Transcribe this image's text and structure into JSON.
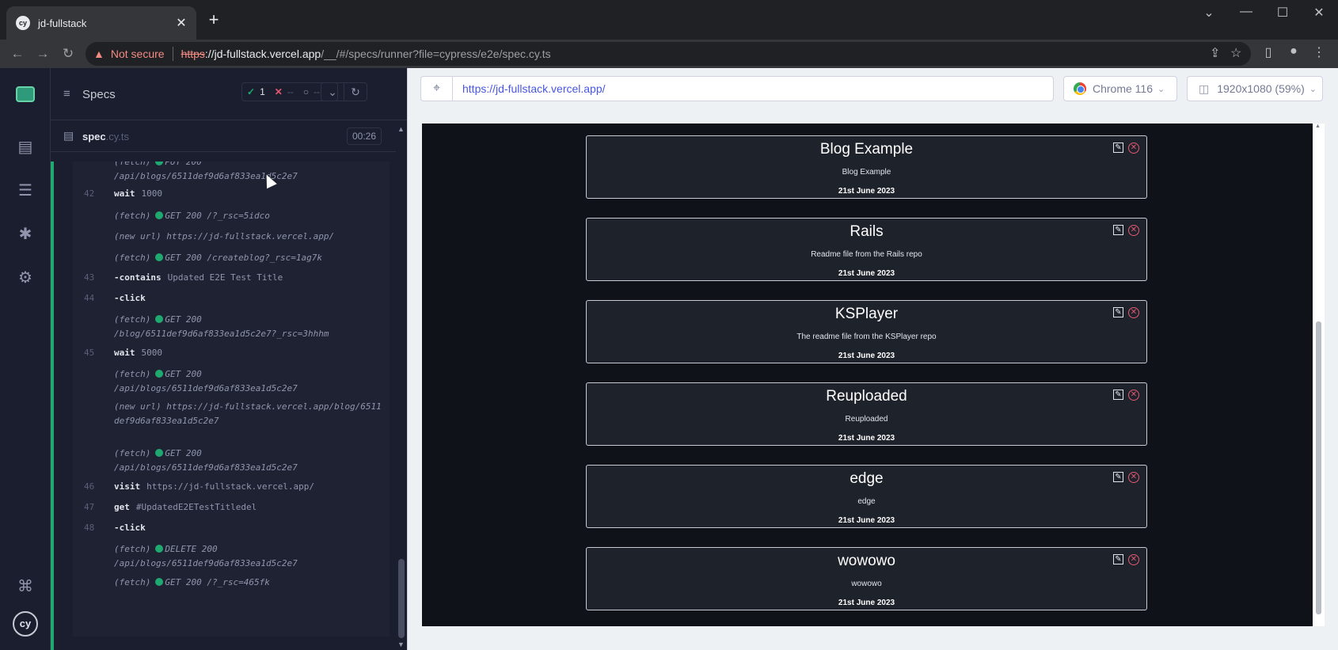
{
  "browser": {
    "tab_title": "jd-fullstack",
    "tab_favicon": "cy",
    "security_label": "Not secure",
    "url_scheme": "https",
    "url_host": "://jd-fullstack.vercel.app",
    "url_path": "/__/#/specs/runner?file=cypress/e2e/spec.cy.ts"
  },
  "reporter": {
    "specs_label": "Specs",
    "stats": {
      "passed": "1",
      "failed": "--",
      "pending": "--"
    },
    "file": {
      "name": "spec",
      "ext": ".cy.ts",
      "duration": "00:26"
    },
    "commands": [
      {
        "num": "",
        "text": "(fetch)",
        "method": "PUT 200",
        "path": "/api/blogs/6511def9d6af833ea1d5c2e7",
        "kind": "fetch"
      },
      {
        "num": "42",
        "name": "wait",
        "arg": "1000",
        "kind": "cmd"
      },
      {
        "num": "",
        "text": "(fetch)",
        "method": "GET 200 /?_rsc=5idco",
        "path": "",
        "kind": "fetch"
      },
      {
        "num": "",
        "text": "(new url)",
        "method": "",
        "path": "https://jd-fullstack.vercel.app/",
        "kind": "newurl"
      },
      {
        "num": "",
        "text": "(fetch)",
        "method": "GET 200 /createblog?_rsc=1ag7k",
        "path": "",
        "kind": "fetch"
      },
      {
        "num": "43",
        "name": "-contains",
        "arg": "Updated E2E Test Title",
        "kind": "cmd"
      },
      {
        "num": "44",
        "name": "-click",
        "arg": "",
        "kind": "cmd"
      },
      {
        "num": "",
        "text": "(fetch)",
        "method": "GET 200",
        "path": "/blog/6511def9d6af833ea1d5c2e7?_rsc=3hhhm",
        "kind": "fetch"
      },
      {
        "num": "45",
        "name": "wait",
        "arg": "5000",
        "kind": "cmd"
      },
      {
        "num": "",
        "text": "(fetch)",
        "method": "GET 200",
        "path": "/api/blogs/6511def9d6af833ea1d5c2e7",
        "kind": "fetch"
      },
      {
        "num": "",
        "text": "(new url)",
        "method": "",
        "path": "https://jd-fullstack.vercel.app/blog/6511def9d6af833ea1d5c2e7",
        "kind": "newurl"
      },
      {
        "num": "",
        "text": "(fetch)",
        "method": "GET 200",
        "path": "/api/blogs/6511def9d6af833ea1d5c2e7",
        "kind": "fetch"
      },
      {
        "num": "46",
        "name": "visit",
        "arg": "https://jd-fullstack.vercel.app/",
        "kind": "cmd"
      },
      {
        "num": "47",
        "name": "get",
        "arg": "#UpdatedE2ETestTitledel",
        "kind": "cmd"
      },
      {
        "num": "48",
        "name": "-click",
        "arg": "",
        "kind": "cmd"
      },
      {
        "num": "",
        "text": "(fetch)",
        "method": "DELETE 200",
        "path": "/api/blogs/6511def9d6af833ea1d5c2e7",
        "kind": "fetch"
      },
      {
        "num": "",
        "text": "(fetch)",
        "method": "GET 200 /?_rsc=465fk",
        "path": "",
        "kind": "fetch"
      }
    ]
  },
  "aut": {
    "url": "https://jd-fullstack.vercel.app/",
    "browser_name": "Chrome 116",
    "viewport": "1920x1080 (59%)",
    "blogs": [
      {
        "title": "Blog Example",
        "description": "Blog Example",
        "date": "21st June 2023"
      },
      {
        "title": "Rails",
        "description": "Readme file from the Rails repo",
        "date": "21st June 2023"
      },
      {
        "title": "KSPlayer",
        "description": "The readme file from the KSPlayer repo",
        "date": "21st June 2023"
      },
      {
        "title": "Reuploaded",
        "description": "Reuploaded",
        "date": "21st June 2023"
      },
      {
        "title": "edge",
        "description": "edge",
        "date": "21st June 2023"
      },
      {
        "title": "wowowo",
        "description": "wowowo",
        "date": "21st June 2023"
      }
    ]
  },
  "colors": {
    "pass": "#1fa971",
    "fail": "#e45770",
    "link": "#4956e3",
    "sidebar_bg": "#1b1e2e"
  }
}
